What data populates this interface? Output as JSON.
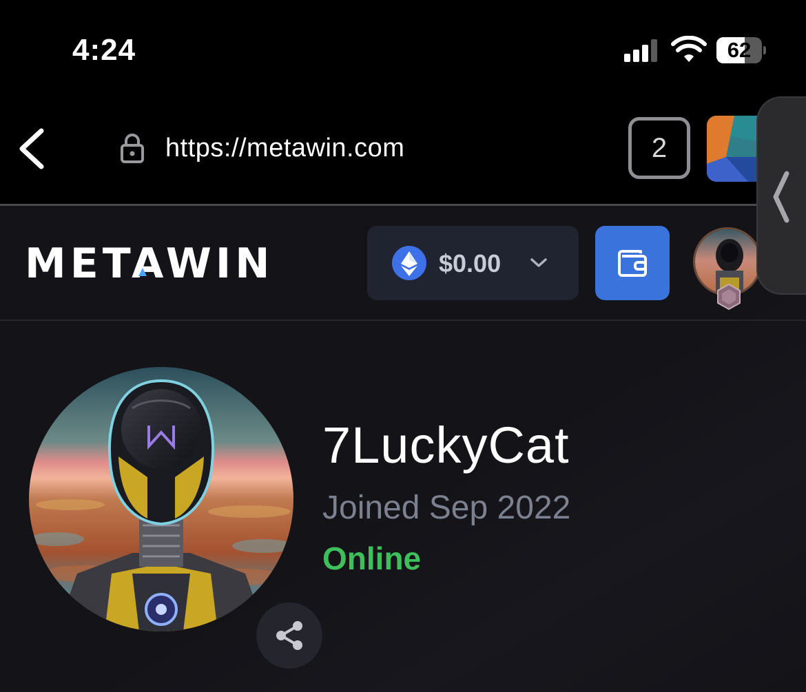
{
  "status_bar": {
    "time": "4:24",
    "battery_level": "62",
    "battery_fraction": 0.62
  },
  "browser": {
    "url": "https://metawin.com",
    "tab_count": "2",
    "icons": [
      "back-chevron-icon",
      "lock-icon",
      "tabs-icon",
      "side-panel-chevron-icon"
    ]
  },
  "site_header": {
    "logo_text": "METAWIN",
    "balance": "$0.00",
    "currency_icon": "ethereum-icon",
    "wallet_icon": "wallet-icon"
  },
  "profile": {
    "username": "7LuckyCat",
    "joined": "Joined Sep 2022",
    "status": "Online",
    "status_color": "#3fbf5b",
    "share_icon": "share-icon"
  },
  "colors": {
    "site_background": "#131318",
    "balance_chip": "#202430",
    "wallet_button": "#3a73db",
    "eth_blue": "#3e71e8"
  }
}
